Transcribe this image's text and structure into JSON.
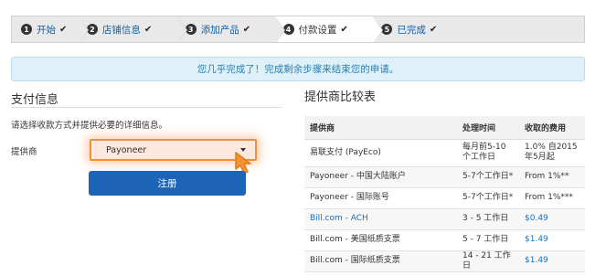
{
  "steps": [
    {
      "num": "1",
      "label": "开始",
      "check": "✔"
    },
    {
      "num": "2",
      "label": "店铺信息",
      "check": "✔"
    },
    {
      "num": "3",
      "label": "添加产品",
      "check": "✔"
    },
    {
      "num": "4",
      "label": "付款设置",
      "check": "✔"
    },
    {
      "num": "5",
      "label": "已完成",
      "check": "✔"
    }
  ],
  "alert": "您几乎完成了！完成剩余步骤来结束您的申请。",
  "payment": {
    "title": "支付信息",
    "instructions": "请选择收款方式并提供必要的详细信息。",
    "provider_label": "提供商",
    "provider_value": "Payoneer",
    "submit_label": "注册"
  },
  "comparison": {
    "title": "提供商比较表",
    "headers": [
      "提供商",
      "处理时间",
      "收取的费用"
    ],
    "rows": [
      {
        "provider": "易联支付 (PayEco)",
        "time": "每月前5-10个工作日",
        "fee": "1.0% 自2015年5月起",
        "link": false
      },
      {
        "provider": "Payoneer - 中国大陆账户",
        "time": "5-7个工作日*",
        "fee": "From 1%**",
        "link": false
      },
      {
        "provider": "Payoneer - 国际账号",
        "time": "5-7个工作日*",
        "fee": "From 1%***",
        "link": false
      },
      {
        "provider": "Bill.com - ACH",
        "time": "3 - 5 工作日",
        "fee": "$0.49",
        "link": true
      },
      {
        "provider": "Bill.com - 美国纸质支票",
        "time": "5 - 7 工作日",
        "fee": "$1.49",
        "link": false
      },
      {
        "provider": "Bill.com - 国际纸质支票",
        "time": "14 - 21 工作日",
        "fee": "$1.49",
        "link": false
      }
    ]
  }
}
